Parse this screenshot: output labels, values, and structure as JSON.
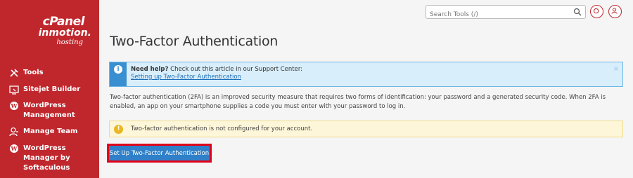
{
  "sidebar": {
    "logo": {
      "cpanel": "cPanel",
      "inmotion": "inmotion.",
      "hosting": "hosting"
    },
    "items": [
      {
        "label": "Tools",
        "icon": "tools-icon"
      },
      {
        "label": "Sitejet Builder",
        "icon": "sitejet-builder-icon"
      },
      {
        "label": "WordPress\nManagement",
        "icon": "wordpress-icon"
      },
      {
        "label": "Manage Team",
        "icon": "team-icon"
      },
      {
        "label": "WordPress\nManager by\nSoftaculous",
        "icon": "wordpress-icon"
      }
    ]
  },
  "header": {
    "search_placeholder": "Search Tools (/)",
    "notifications_icon": "notifications-icon",
    "user_icon": "user-icon"
  },
  "main": {
    "title": "Two-Factor Authentication",
    "help": {
      "bold": "Need help?",
      "text": " Check out this article in our Support Center:",
      "link": "Setting up Two-Factor Authentication",
      "close": "×"
    },
    "description": "Two-factor authentication (2FA) is an improved security measure that requires two forms of identification: your password and a generated security code. When 2FA is enabled, an app on your smartphone supplies a code you must enter with your password to log in.",
    "warning": "Two-factor authentication is not configured for your account.",
    "setup_button": "Set Up Two-Factor Authentication"
  },
  "colors": {
    "sidebar": "#c0272d",
    "accent": "#2f80c9",
    "highlight": "#e1001a"
  }
}
